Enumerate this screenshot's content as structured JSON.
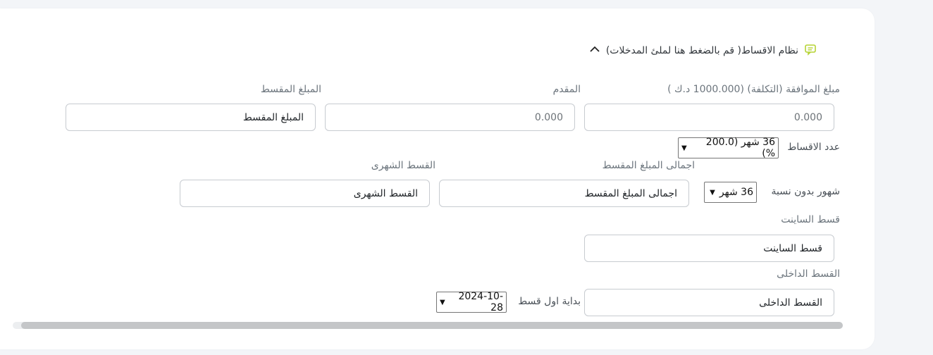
{
  "section": {
    "title": "نظام الاقساط( قم بالضغط هنا لملئ المدخلات)"
  },
  "fields": {
    "approved_amount_label": "مبلغ الموافقة (التكلفة) (1000.000 د.ك )",
    "approved_amount_value": "0.000",
    "down_payment_label": "المقدم",
    "down_payment_value": "0.000",
    "installment_amount_label": "المبلغ المقسط",
    "installment_amount_placeholder": "المبلغ المقسط",
    "installments_count_label": "عدد الاقساط",
    "installments_count_value": "36 شهر (200.0 %)",
    "total_installment_label": "اجمالى المبلغ المقسط",
    "total_installment_placeholder": "اجمالى المبلغ المقسط",
    "monthly_installment_label": "القسط الشهرى",
    "monthly_installment_placeholder": "القسط الشهرى",
    "interest_free_label": "شهور بدون نسبة",
    "interest_free_value": "36 شهر",
    "cyient_installment_label": "قسط الساينت",
    "cyient_installment_placeholder": "قسط الساينت",
    "internal_installment_label": "القسط الداخلى",
    "internal_installment_placeholder": "القسط الداخلى",
    "first_installment_label": "بداية اول قسط",
    "first_installment_value": "2024-10-28"
  },
  "icons": {
    "section": "message-icon",
    "toggle": "chevron-up-icon"
  },
  "colors": {
    "accent_icon": "#b5d334",
    "border": "#c7cbd0",
    "label": "#6c757d"
  }
}
